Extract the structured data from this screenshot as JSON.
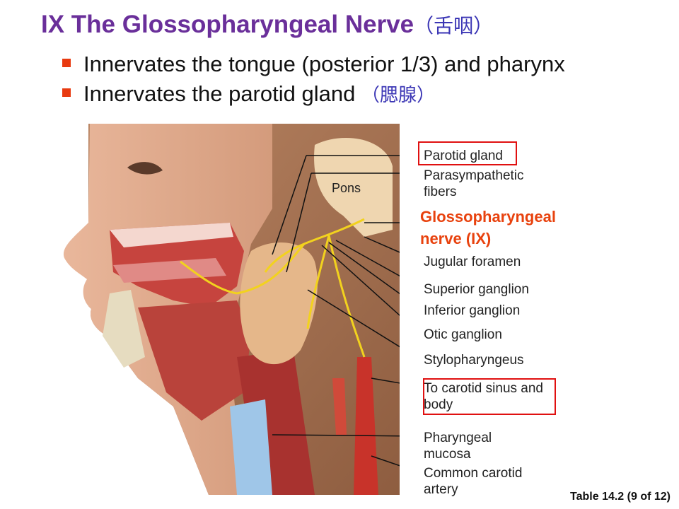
{
  "title": {
    "main": "IX The Glossopharyngeal  Nerve",
    "chinese": "（舌咽）"
  },
  "bullets": [
    {
      "text": "Innervates  the tongue (posterior 1/3) and pharynx",
      "chinese": ""
    },
    {
      "text": "Innervates  the parotid  gland ",
      "chinese": "（腮腺）"
    }
  ],
  "figure": {
    "pons_label": "Pons",
    "labels": {
      "parotid_gland": "Parotid gland",
      "parasympathetic_1": "Parasympathetic",
      "parasympathetic_2": "fibers",
      "glosso_1": "Glossopharyngeal",
      "glosso_2": "nerve (IX)",
      "jugular": "Jugular foramen",
      "superior": "Superior ganglion",
      "inferior": "Inferior ganglion",
      "otic": "Otic ganglion",
      "stylo": "Stylopharyngeus",
      "carotid_sinus_1": "To carotid sinus and",
      "carotid_sinus_2": "body",
      "pharyngeal_1": "Pharyngeal",
      "pharyngeal_2": "mucosa",
      "common_carotid_1": "Common carotid",
      "common_carotid_2": "artery"
    }
  },
  "colors": {
    "title": "#6a2f9a",
    "chinese": "#3b36b5",
    "bullet_square": "#e83a10",
    "highlight_box": "#e01010",
    "nerve_label": "#e8420e",
    "nerve": "#f2d21e"
  },
  "caption": "Table 14.2 (9 of 12)"
}
